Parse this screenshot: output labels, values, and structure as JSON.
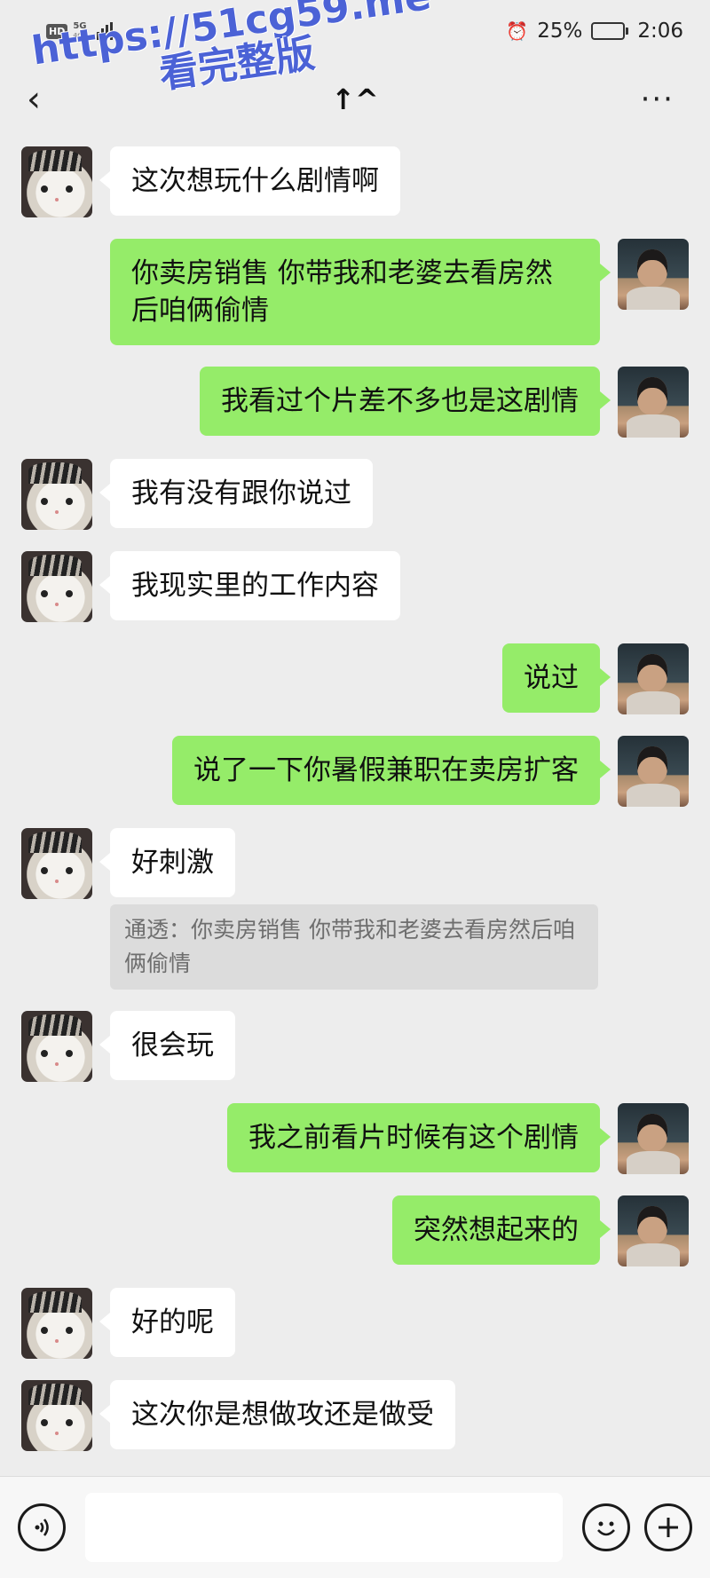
{
  "status_bar": {
    "hd": "HD",
    "network": "5G",
    "network_sub": "4G",
    "battery": "25%",
    "battery_level": 0.25,
    "time": "2:06"
  },
  "nav": {
    "back_icon": "‹",
    "title": "↑^",
    "more_icon": "···"
  },
  "watermark": {
    "url": "https://51cg59.me",
    "cta": "看完整版"
  },
  "messages": [
    {
      "side": "left",
      "avatar": "cat",
      "text": "这次想玩什么剧情啊"
    },
    {
      "side": "right",
      "avatar": "boy",
      "text": "你卖房销售  你带我和老婆去看房然后咱俩偷情"
    },
    {
      "side": "right",
      "avatar": "boy",
      "text": "我看过个片差不多也是这剧情"
    },
    {
      "side": "left",
      "avatar": "cat",
      "text": "我有没有跟你说过"
    },
    {
      "side": "left",
      "avatar": "cat",
      "text": "我现实里的工作内容"
    },
    {
      "side": "right",
      "avatar": "boy",
      "text": "说过"
    },
    {
      "side": "right",
      "avatar": "boy",
      "text": "说了一下你暑假兼职在卖房扩客"
    },
    {
      "side": "left",
      "avatar": "cat",
      "text": "好刺激",
      "quote": "通透：你卖房销售  你带我和老婆去看房然后咱俩偷情"
    },
    {
      "side": "left",
      "avatar": "cat",
      "text": "很会玩"
    },
    {
      "side": "right",
      "avatar": "boy",
      "text": "我之前看片时候有这个剧情"
    },
    {
      "side": "right",
      "avatar": "boy",
      "text": "突然想起来的"
    },
    {
      "side": "left",
      "avatar": "cat",
      "text": "好的呢"
    },
    {
      "side": "left",
      "avatar": "cat",
      "text": "这次你是想做攻还是做受"
    }
  ],
  "input_bar": {
    "voice_icon": "voice-icon",
    "emoji_icon": "emoji-icon",
    "plus_icon": "plus-icon",
    "input_value": ""
  },
  "colors": {
    "background": "#ededed",
    "sent_bubble": "#95ec69",
    "received_bubble": "#ffffff",
    "quote_bg": "#dcdcdc",
    "watermark": "#4b62d6"
  }
}
